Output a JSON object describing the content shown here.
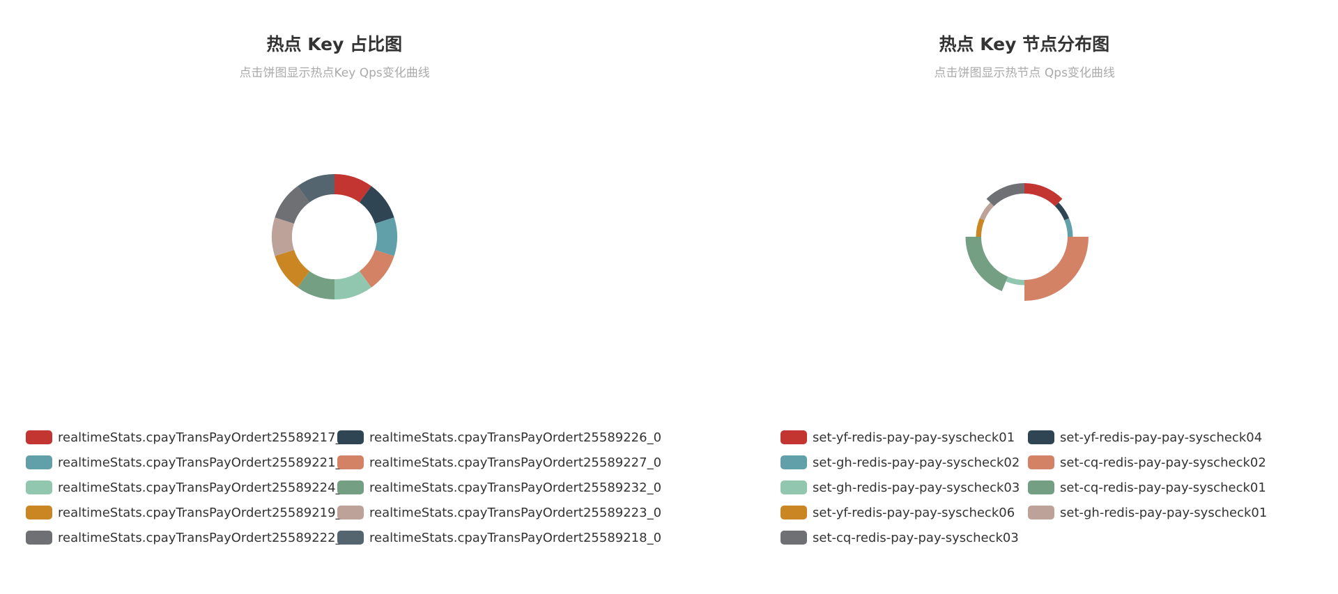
{
  "chart_data": [
    {
      "type": "pie",
      "variant": "donut",
      "title": "热点 Key 占比图",
      "subtitle": "点击饼图显示热点Key Qps变化曲线",
      "legend_position": "bottom",
      "categories": [
        "realtimeStats.cpayTransPayOrdert25589217_0",
        "realtimeStats.cpayTransPayOrdert25589226_0",
        "realtimeStats.cpayTransPayOrdert25589221_0",
        "realtimeStats.cpayTransPayOrdert25589227_0",
        "realtimeStats.cpayTransPayOrdert25589224_0",
        "realtimeStats.cpayTransPayOrdert25589232_0",
        "realtimeStats.cpayTransPayOrdert25589219_0",
        "realtimeStats.cpayTransPayOrdert25589223_0",
        "realtimeStats.cpayTransPayOrdert25589222_0",
        "realtimeStats.cpayTransPayOrdert25589218_0"
      ],
      "values": [
        10,
        10,
        10,
        10,
        10,
        10,
        10,
        10,
        10,
        10
      ],
      "colors": [
        "#c23531",
        "#2f4554",
        "#61a0a8",
        "#d48265",
        "#91c7ae",
        "#749f83",
        "#ca8622",
        "#bda29a",
        "#6e7074",
        "#546570"
      ]
    },
    {
      "type": "pie",
      "variant": "nightingale-rose",
      "title": "热点 Key 节点分布图",
      "subtitle": "点击饼图显示热节点 Qps变化曲线",
      "legend_position": "bottom",
      "categories": [
        "set-yf-redis-pay-pay-syscheck01",
        "set-yf-redis-pay-pay-syscheck04",
        "set-gh-redis-pay-pay-syscheck02",
        "set-cq-redis-pay-pay-syscheck02",
        "set-gh-redis-pay-pay-syscheck03",
        "set-cq-redis-pay-pay-syscheck01",
        "set-yf-redis-pay-pay-syscheck06",
        "set-gh-redis-pay-pay-syscheck01",
        "set-cq-redis-pay-pay-syscheck03"
      ],
      "values": [
        2,
        1,
        1,
        4,
        1,
        3,
        1,
        1,
        2
      ],
      "colors": [
        "#c23531",
        "#2f4554",
        "#61a0a8",
        "#d48265",
        "#91c7ae",
        "#749f83",
        "#ca8622",
        "#bda29a",
        "#6e7074"
      ]
    }
  ]
}
